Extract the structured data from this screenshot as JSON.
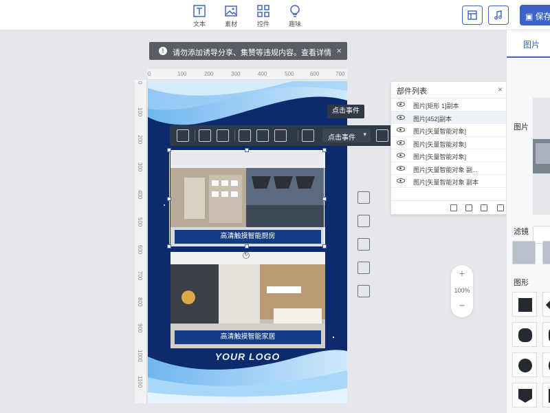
{
  "toolbar": {
    "tools": [
      {
        "label": "文本",
        "icon": "text-icon"
      },
      {
        "label": "素材",
        "icon": "image-icon"
      },
      {
        "label": "控件",
        "icon": "widgets-icon"
      },
      {
        "label": "趣味",
        "icon": "bulb-icon"
      }
    ],
    "save_label": "保存"
  },
  "notice": {
    "text": "请勿添加诱导分享、集赞等违规内容。查看详情",
    "close": "×"
  },
  "ruler": {
    "h": [
      "0",
      "100",
      "200",
      "300",
      "400",
      "500",
      "600",
      "700"
    ],
    "v": [
      "0",
      "100",
      "200",
      "300",
      "400",
      "500",
      "600",
      "700",
      "800",
      "900",
      "1000",
      "1100"
    ]
  },
  "poster": {
    "caption1": "高清触摸智能厨房",
    "caption2": "高清触摸智能家居",
    "logo": "YOUR LOGO"
  },
  "float_toolbar": {
    "event_select": "点击事件",
    "tooltip": "点击事件"
  },
  "layers_panel": {
    "title": "部件列表",
    "close": "×",
    "items": [
      "图片[矩形 1]副本",
      "图片[452]副本",
      "图片[矢量智能对象]",
      "图片[矢量智能对象]",
      "图片[矢量智能对象]",
      "图片[矢量智能对象 副...",
      "图片[矢量智能对象 副本"
    ]
  },
  "zoom": {
    "plus": "+",
    "value": "100%",
    "minus": "−"
  },
  "right_panel": {
    "tab": "图片",
    "image_label": "图片",
    "filter_label": "滤镜",
    "shape_label": "图形"
  },
  "colors": {
    "accent": "#3b63c8",
    "poster_bg": "#0b2b6c",
    "toolbar_dark": "#2f3846"
  }
}
